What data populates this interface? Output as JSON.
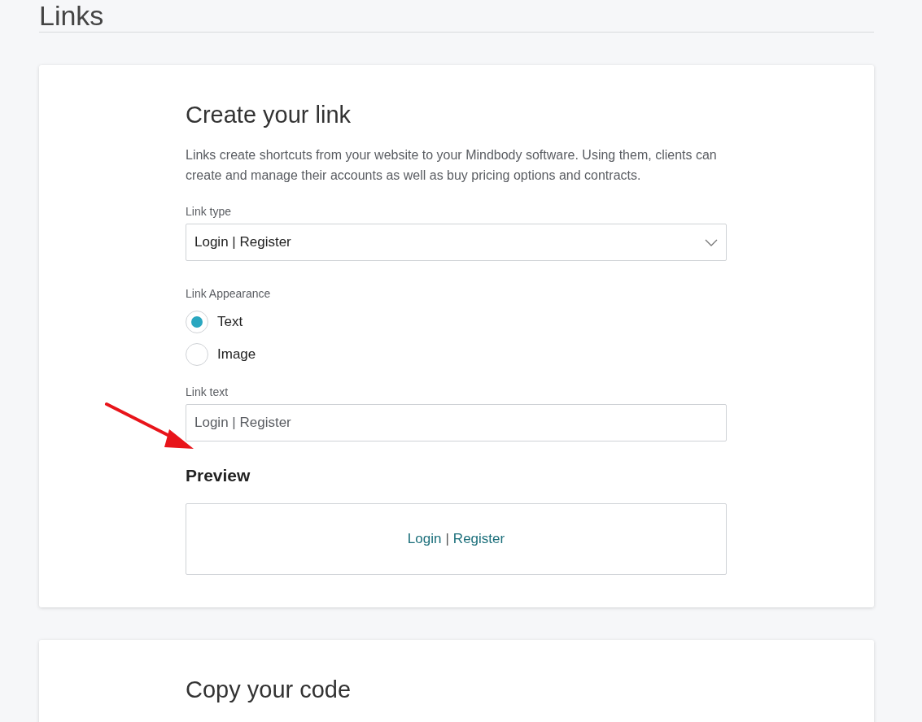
{
  "page_title": "Links",
  "create_card": {
    "heading": "Create your link",
    "description": "Links create shortcuts from your website to your Mindbody software. Using them, clients can create and manage their accounts as well as buy pricing options and contracts.",
    "link_type": {
      "label": "Link type",
      "value": "Login | Register"
    },
    "appearance": {
      "label": "Link Appearance",
      "options": [
        {
          "label": "Text",
          "selected": true
        },
        {
          "label": "Image",
          "selected": false
        }
      ]
    },
    "link_text": {
      "label": "Link text",
      "value": "Login | Register"
    },
    "preview": {
      "heading": "Preview",
      "links": [
        "Login",
        "Register"
      ],
      "separator": "|"
    }
  },
  "code_card": {
    "heading": "Copy your code"
  }
}
